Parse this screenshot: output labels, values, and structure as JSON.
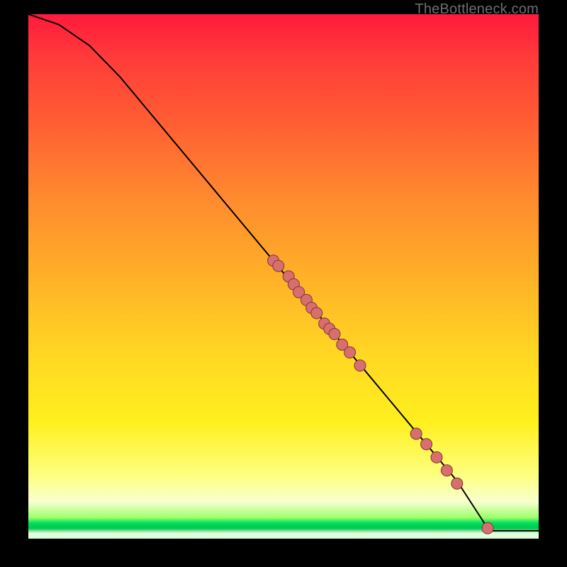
{
  "watermark": "TheBottleneck.com",
  "chart_data": {
    "type": "line",
    "title": "",
    "xlabel": "",
    "ylabel": "",
    "xlim": [
      0,
      100
    ],
    "ylim": [
      0,
      100
    ],
    "grid": false,
    "legend": false,
    "curve": [
      {
        "x": 0,
        "y": 100
      },
      {
        "x": 6,
        "y": 98
      },
      {
        "x": 12,
        "y": 94
      },
      {
        "x": 18,
        "y": 88
      },
      {
        "x": 24,
        "y": 81
      },
      {
        "x": 30,
        "y": 74
      },
      {
        "x": 36,
        "y": 67
      },
      {
        "x": 42,
        "y": 60
      },
      {
        "x": 48,
        "y": 53
      },
      {
        "x": 54,
        "y": 46
      },
      {
        "x": 60,
        "y": 39
      },
      {
        "x": 66,
        "y": 32
      },
      {
        "x": 72,
        "y": 25
      },
      {
        "x": 78,
        "y": 18
      },
      {
        "x": 84,
        "y": 11
      },
      {
        "x": 88,
        "y": 5
      },
      {
        "x": 90,
        "y": 2
      },
      {
        "x": 91,
        "y": 1.5
      },
      {
        "x": 100,
        "y": 1.5
      }
    ],
    "points": [
      {
        "x": 48,
        "y": 53
      },
      {
        "x": 49,
        "y": 52
      },
      {
        "x": 51,
        "y": 50
      },
      {
        "x": 52,
        "y": 48.5
      },
      {
        "x": 53,
        "y": 47
      },
      {
        "x": 54.5,
        "y": 45.5
      },
      {
        "x": 55.5,
        "y": 44
      },
      {
        "x": 56.5,
        "y": 43
      },
      {
        "x": 58,
        "y": 41
      },
      {
        "x": 59,
        "y": 40
      },
      {
        "x": 60,
        "y": 39
      },
      {
        "x": 61.5,
        "y": 37
      },
      {
        "x": 63,
        "y": 35.5
      },
      {
        "x": 65,
        "y": 33
      },
      {
        "x": 76,
        "y": 20
      },
      {
        "x": 78,
        "y": 18
      },
      {
        "x": 80,
        "y": 15.5
      },
      {
        "x": 82,
        "y": 13
      },
      {
        "x": 84,
        "y": 10.5
      },
      {
        "x": 90,
        "y": 2
      }
    ],
    "point_color": "#d96e6e",
    "point_stroke": "#7a3838",
    "line_color": "#000000"
  }
}
